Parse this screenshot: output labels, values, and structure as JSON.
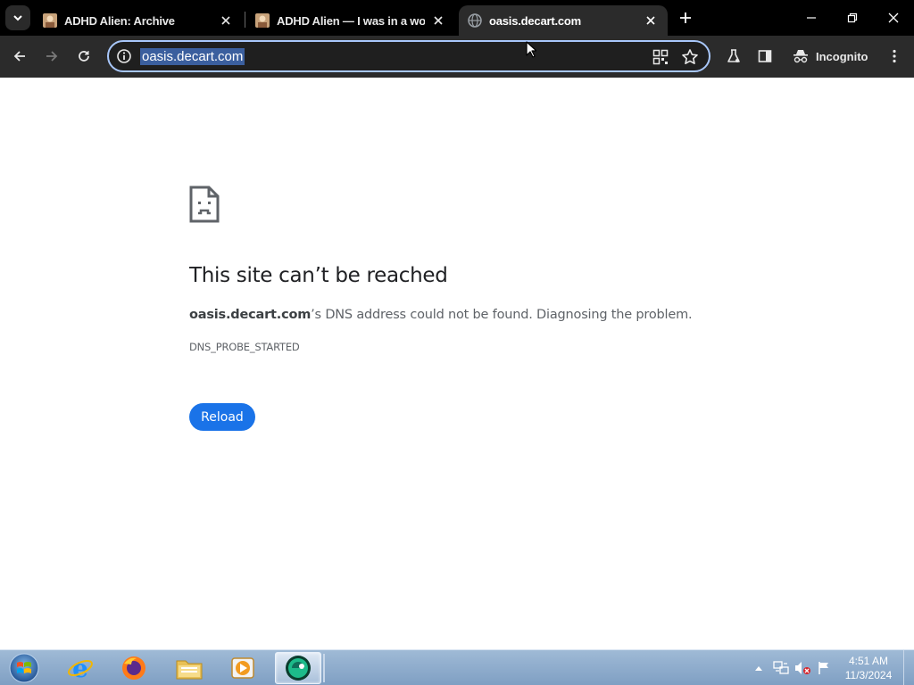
{
  "browser": {
    "tabs": [
      {
        "title": "ADHD Alien: Archive",
        "active": false
      },
      {
        "title": "ADHD Alien — I was in a work",
        "active": false
      },
      {
        "title": "oasis.decart.com",
        "active": true
      }
    ],
    "address": {
      "url": "oasis.decart.com"
    },
    "profile_label": "Incognito"
  },
  "error_page": {
    "title": "This site can’t be reached",
    "host": "oasis.decart.com",
    "description_rest": "’s DNS address could not be found. Diagnosing the problem.",
    "error_code": "DNS_PROBE_STARTED",
    "reload_label": "Reload"
  },
  "taskbar": {
    "apps": [
      "internet-explorer",
      "firefox",
      "file-explorer",
      "media-player",
      "browser-app"
    ],
    "clock": {
      "time": "4:51 AM",
      "date": "11/3/2024"
    }
  },
  "colors": {
    "accent": "#1a73e8",
    "omnibox_focus": "#a8c7fa",
    "tabstrip": "#000000",
    "toolbar": "#2b2b2b"
  }
}
